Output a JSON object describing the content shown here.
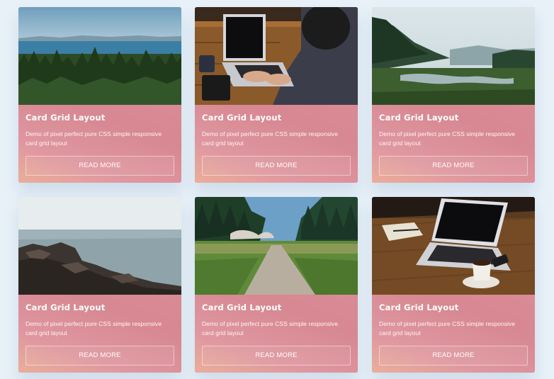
{
  "cards": [
    {
      "image": "forest-lake-landscape",
      "title": "Card Grid Layout",
      "description": "Demo of pixel perfect pure CSS simple responsive card grid layout",
      "button_label": "READ MORE"
    },
    {
      "image": "person-typing-on-laptop",
      "title": "Card Grid Layout",
      "description": "Demo of pixel perfect pure CSS simple responsive card grid layout",
      "button_label": "READ MORE"
    },
    {
      "image": "misty-river-valley",
      "title": "Card Grid Layout",
      "description": "Demo of pixel perfect pure CSS simple responsive card grid layout",
      "button_label": "READ MORE"
    },
    {
      "image": "rocky-seashore",
      "title": "Card Grid Layout",
      "description": "Demo of pixel perfect pure CSS simple responsive card grid layout",
      "button_label": "READ MORE"
    },
    {
      "image": "forest-path",
      "title": "Card Grid Layout",
      "description": "Demo of pixel perfect pure CSS simple responsive card grid layout",
      "button_label": "READ MORE"
    },
    {
      "image": "laptop-coffee-desk",
      "title": "Card Grid Layout",
      "description": "Demo of pixel perfect pure CSS simple responsive card grid layout",
      "button_label": "READ MORE"
    }
  ],
  "colors": {
    "page_background": "#e8f1f8",
    "card_content_top": "#d98a96",
    "card_content_bottom": "#eaae9a",
    "text": "#ffffff"
  }
}
